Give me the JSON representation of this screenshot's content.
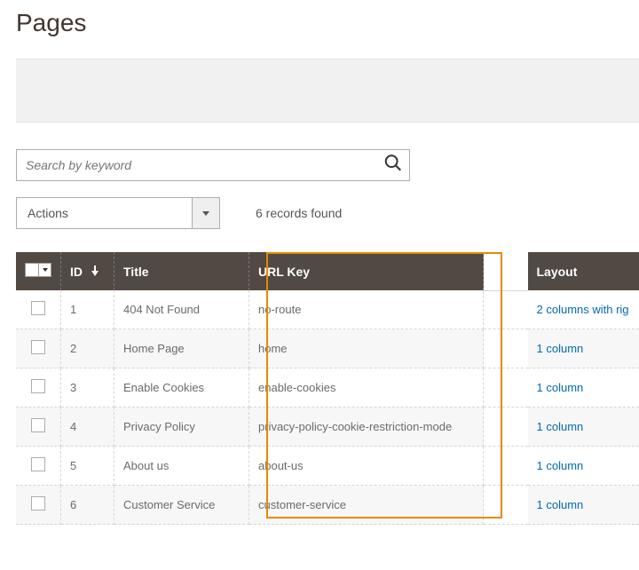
{
  "page": {
    "title": "Pages"
  },
  "search": {
    "placeholder": "Search by keyword"
  },
  "actions": {
    "label": "Actions"
  },
  "records": {
    "text": "6 records found"
  },
  "columns": {
    "id": "ID",
    "title": "Title",
    "urlkey": "URL Key",
    "layout": "Layout"
  },
  "rows": [
    {
      "id": "1",
      "title": "404 Not Found",
      "urlkey": "no-route",
      "layout": "2 columns with rig"
    },
    {
      "id": "2",
      "title": "Home Page",
      "urlkey": "home",
      "layout": "1 column"
    },
    {
      "id": "3",
      "title": "Enable Cookies",
      "urlkey": "enable-cookies",
      "layout": "1 column"
    },
    {
      "id": "4",
      "title": "Privacy Policy",
      "urlkey": "privacy-policy-cookie-restriction-mode",
      "layout": "1 column"
    },
    {
      "id": "5",
      "title": "About us",
      "urlkey": "about-us",
      "layout": "1 column"
    },
    {
      "id": "6",
      "title": "Customer Service",
      "urlkey": "customer-service",
      "layout": "1 column"
    }
  ]
}
